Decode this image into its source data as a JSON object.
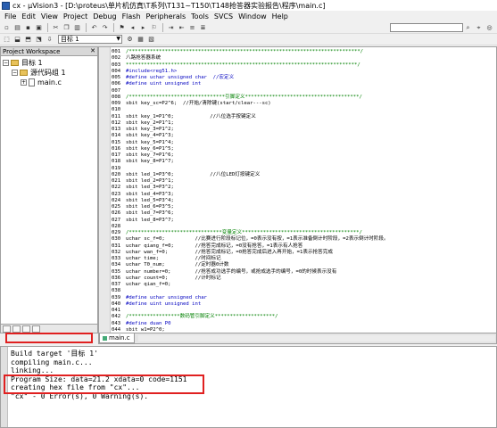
{
  "window": {
    "title": "cx - µVision3 - [D:\\proteus\\单片机仿真\\T系列\\T131~T150\\T148抢答器实验报告\\程序\\main.c]"
  },
  "menu": [
    "File",
    "Edit",
    "View",
    "Project",
    "Debug",
    "Flash",
    "Peripherals",
    "Tools",
    "SVCS",
    "Window",
    "Help"
  ],
  "toolbar": {
    "target": "目标 1"
  },
  "workspace": {
    "title": "Project Workspace",
    "tree": [
      "目标 1",
      "源代码组 1",
      "main.c"
    ]
  },
  "editor": {
    "tab": "main.c",
    "lines": [
      {
        "n": "001",
        "code": "/*****************************************************************************/"
      },
      {
        "n": "002",
        "code": "八路抢答器系统"
      },
      {
        "n": "003",
        "code": "*****************************************************************************/"
      },
      {
        "n": "004",
        "code": "#include<reg51.h>"
      },
      {
        "n": "005",
        "code": "#define uchar unsigned char  //宏定义"
      },
      {
        "n": "006",
        "code": "#define uint unsigned int"
      },
      {
        "n": "007",
        "code": ""
      },
      {
        "n": "008",
        "code": "/********************************引脚定义**************************************/"
      },
      {
        "n": "009",
        "code": "sbit key_sc=P2^6;  //开始/清除键(start/clear---sc)"
      },
      {
        "n": "010",
        "code": ""
      },
      {
        "n": "011",
        "code": "sbit key_1=P1^0;            //八位选手按键定义"
      },
      {
        "n": "012",
        "code": "sbit key_2=P1^1;"
      },
      {
        "n": "013",
        "code": "sbit key_3=P1^2;"
      },
      {
        "n": "014",
        "code": "sbit key_4=P1^3;"
      },
      {
        "n": "015",
        "code": "sbit key_5=P1^4;"
      },
      {
        "n": "016",
        "code": "sbit key_6=P1^5;"
      },
      {
        "n": "017",
        "code": "sbit key_7=P1^6;"
      },
      {
        "n": "018",
        "code": "sbit key_8=P1^7;"
      },
      {
        "n": "019",
        "code": ""
      },
      {
        "n": "020",
        "code": "sbit led_1=P3^0;            //八位LED灯按键定义"
      },
      {
        "n": "021",
        "code": "sbit led_2=P3^1;"
      },
      {
        "n": "022",
        "code": "sbit led_3=P3^2;"
      },
      {
        "n": "023",
        "code": "sbit led_4=P3^3;"
      },
      {
        "n": "024",
        "code": "sbit led_5=P3^4;"
      },
      {
        "n": "025",
        "code": "sbit led_6=P3^5;"
      },
      {
        "n": "026",
        "code": "sbit led_7=P3^6;"
      },
      {
        "n": "027",
        "code": "sbit led_8=P3^7;"
      },
      {
        "n": "028",
        "code": ""
      },
      {
        "n": "029",
        "code": "/*******************************变量定义***************************************/"
      },
      {
        "n": "030",
        "code": "uchar sc_f=0;          //比赛进行阶段标记位，=0表示没有按，=1表示准备倒计时阶段，=2表示倒计时阶段。"
      },
      {
        "n": "031",
        "code": "uchar qiang_f=0;       //抢答完成标记，=0没有抢答，=1表示有人抢答"
      },
      {
        "n": "032",
        "code": "uchar wan_f=0;         //抢答完成标记，=0抢答完成后进入再开始，=1表示抢答完成"
      },
      {
        "n": "033",
        "code": "uchar time;            //时间标记"
      },
      {
        "n": "034",
        "code": "uchar T0_num;          //定时器0计数"
      },
      {
        "n": "035",
        "code": "uchar number=0;        //抢答成功选手的编号，或抢成选手的编号，=0的时候表示没有"
      },
      {
        "n": "036",
        "code": "uchar count=0;         //计时标记"
      },
      {
        "n": "037",
        "code": "uchar qian_f=0;"
      },
      {
        "n": "038",
        "code": ""
      },
      {
        "n": "039",
        "code": "#define uchar unsigned char"
      },
      {
        "n": "040",
        "code": "#define uint unsigned int"
      },
      {
        "n": "041",
        "code": ""
      },
      {
        "n": "042",
        "code": "/*****************数码管引脚定义********************/"
      },
      {
        "n": "043",
        "code": "#define duan P0"
      },
      {
        "n": "044",
        "code": "sbit w1=P2^0;"
      },
      {
        "n": "045",
        "code": "sbit w2=P2^1;"
      },
      {
        "n": "046",
        "code": "sbit w3=P2^2;"
      },
      {
        "n": "047",
        "code": "sbit w4=P2^3;"
      },
      {
        "n": "048",
        "code": ""
      },
      {
        "n": "049",
        "code": "/*****************数码管变量定义********************/"
      }
    ]
  },
  "output": {
    "lines": [
      "Build target '目标 1'",
      "compiling main.c...",
      "linking...",
      "Program Size: data=21.2 xdata=0 code=1151",
      "creating hex file from \"cx\"...",
      "\"cx\" - 0 Error(s), 0 Warning(s)."
    ]
  },
  "colors": {
    "comment": "#008000",
    "keyword": "#0000c0",
    "highlight": "#e02020"
  }
}
